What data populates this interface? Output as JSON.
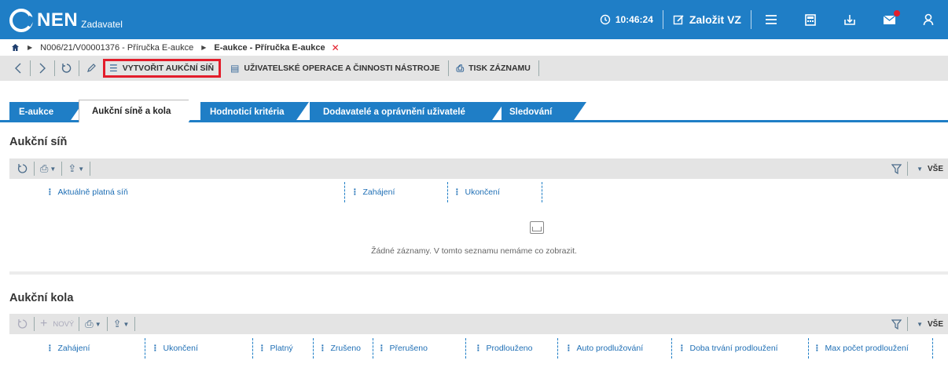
{
  "header": {
    "logo_text": "NEN",
    "role": "Zadavatel",
    "clock": "10:46:24",
    "create_vz_label": "Založit VZ",
    "icons": [
      "clock-icon",
      "edit-icon",
      "menu-icon",
      "calculator-icon",
      "inbox-icon",
      "mail-icon",
      "user-icon"
    ]
  },
  "breadcrumb": {
    "item1": "N006/21/V00001376 - Příručka E-aukce",
    "item2": "E-aukce - Příručka E-aukce"
  },
  "toolbar": {
    "create_hall_label": "VYTVOŘIT AUKČNÍ SÍŇ",
    "user_ops_label": "UŽIVATELSKÉ OPERACE A ČINNOSTI NÁSTROJE",
    "print_label": "TISK ZÁZNAMU"
  },
  "tabs": [
    {
      "label": "E-aukce"
    },
    {
      "label": "Aukční síně a kola",
      "active": true
    },
    {
      "label": "Hodnoticí kritéria"
    },
    {
      "label": "Dodavatelé a oprávnění uživatelé"
    },
    {
      "label": "Sledování"
    }
  ],
  "hall_section": {
    "title": "Aukční síň",
    "all_label": "VŠE",
    "columns": [
      "Aktuálně platná síň",
      "Zahájení",
      "Ukončení"
    ],
    "empty_text": "Žádné záznamy. V tomto seznamu nemáme co zobrazit."
  },
  "rounds_section": {
    "title": "Aukční kola",
    "new_label": "NOVÝ",
    "all_label": "VŠE",
    "columns": [
      "Zahájení",
      "Ukončení",
      "Platný",
      "Zrušeno",
      "Přerušeno",
      "Prodlouženo",
      "Auto prodlužování",
      "Doba trvání prodloužení",
      "Max počet prodloužení"
    ]
  },
  "colors": {
    "brand": "#1f7ec6",
    "highlight": "#e31d2b",
    "toolbar_bg": "#e4e4e4"
  }
}
